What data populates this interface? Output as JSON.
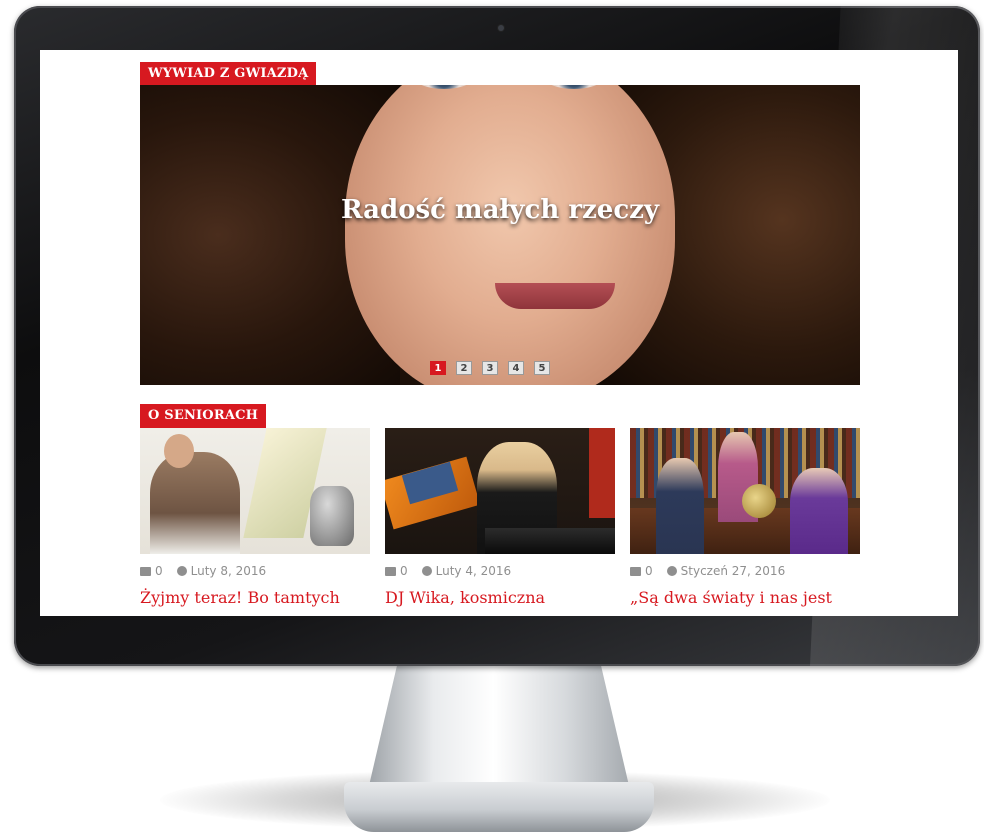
{
  "hero_section": {
    "label": "WYWIAD Z GWIAZDĄ",
    "title": "Radość małych rzeczy",
    "pages": [
      "1",
      "2",
      "3",
      "4",
      "5"
    ],
    "active_page": "1"
  },
  "seniors_section": {
    "label": "O SENIORACH",
    "articles": [
      {
        "comments": "0",
        "date": "Luty 8, 2016",
        "title": "Żyjmy teraz! Bo tamtych"
      },
      {
        "comments": "0",
        "date": "Luty 4, 2016",
        "title": "DJ Wika, kosmiczna"
      },
      {
        "comments": "0",
        "date": "Styczeń 27, 2016",
        "title": "„Są dwa światy i nas jest"
      }
    ]
  },
  "icons": {
    "comment": "comment-icon",
    "clock": "clock-icon"
  },
  "colors": {
    "accent": "#d71920",
    "meta_text": "#8f8f8f",
    "bezel": "#0d0d0e"
  }
}
